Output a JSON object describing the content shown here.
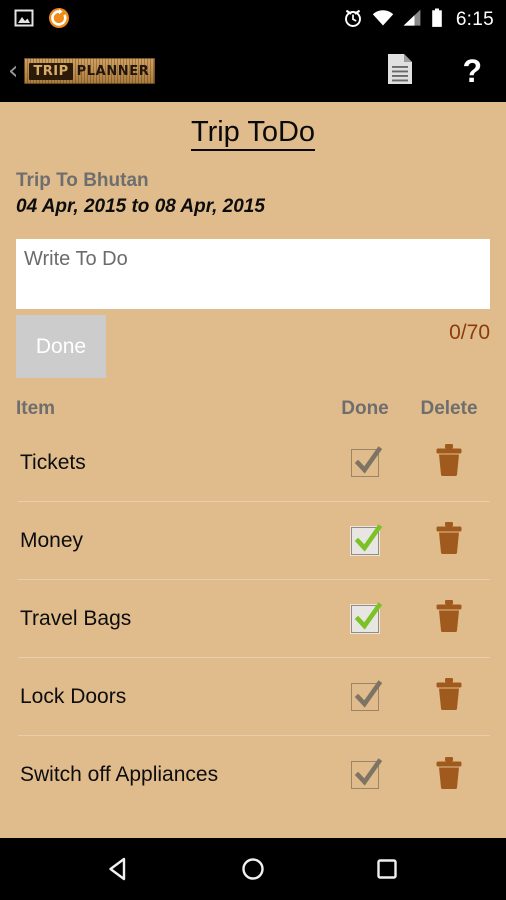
{
  "status_bar": {
    "time": "6:15",
    "left_icons": [
      "image-icon",
      "sync-icon"
    ],
    "right_icons": [
      "alarm-icon",
      "wifi-icon",
      "cell-signal-icon",
      "battery-icon"
    ]
  },
  "action_bar": {
    "back_label": "‹",
    "logo_primary": "TRIP",
    "logo_secondary": "PLANNER",
    "notes_icon": "document-icon",
    "help_icon": "?"
  },
  "page": {
    "title": "Trip ToDo",
    "trip_name": "Trip To Bhutan",
    "trip_dates": "04 Apr, 2015 to 08 Apr, 2015"
  },
  "input": {
    "placeholder": "Write To Do",
    "value": "",
    "done_label": "Done",
    "counter": "0/70"
  },
  "list": {
    "headers": {
      "item": "Item",
      "done": "Done",
      "delete": "Delete"
    },
    "rows": [
      {
        "label": "Tickets",
        "done": false,
        "delete_icon": "trash-icon"
      },
      {
        "label": "Money",
        "done": true,
        "delete_icon": "trash-icon"
      },
      {
        "label": "Travel Bags",
        "done": true,
        "delete_icon": "trash-icon"
      },
      {
        "label": "Lock Doors",
        "done": false,
        "delete_icon": "trash-icon"
      },
      {
        "label": "Switch off Appliances",
        "done": false,
        "delete_icon": "trash-icon"
      }
    ]
  },
  "nav_bar": {
    "back": "back-triangle-icon",
    "home": "home-circle-icon",
    "recents": "recents-square-icon"
  },
  "colors": {
    "background": "#E0BC8C",
    "bar": "#000000",
    "counter_text": "#8C3C0C",
    "trash": "#A05A1E",
    "check_green": "#7CC126",
    "check_gray": "#7E7464",
    "muted_text": "#6E6E6E",
    "done_button": "#CCCCCC"
  }
}
